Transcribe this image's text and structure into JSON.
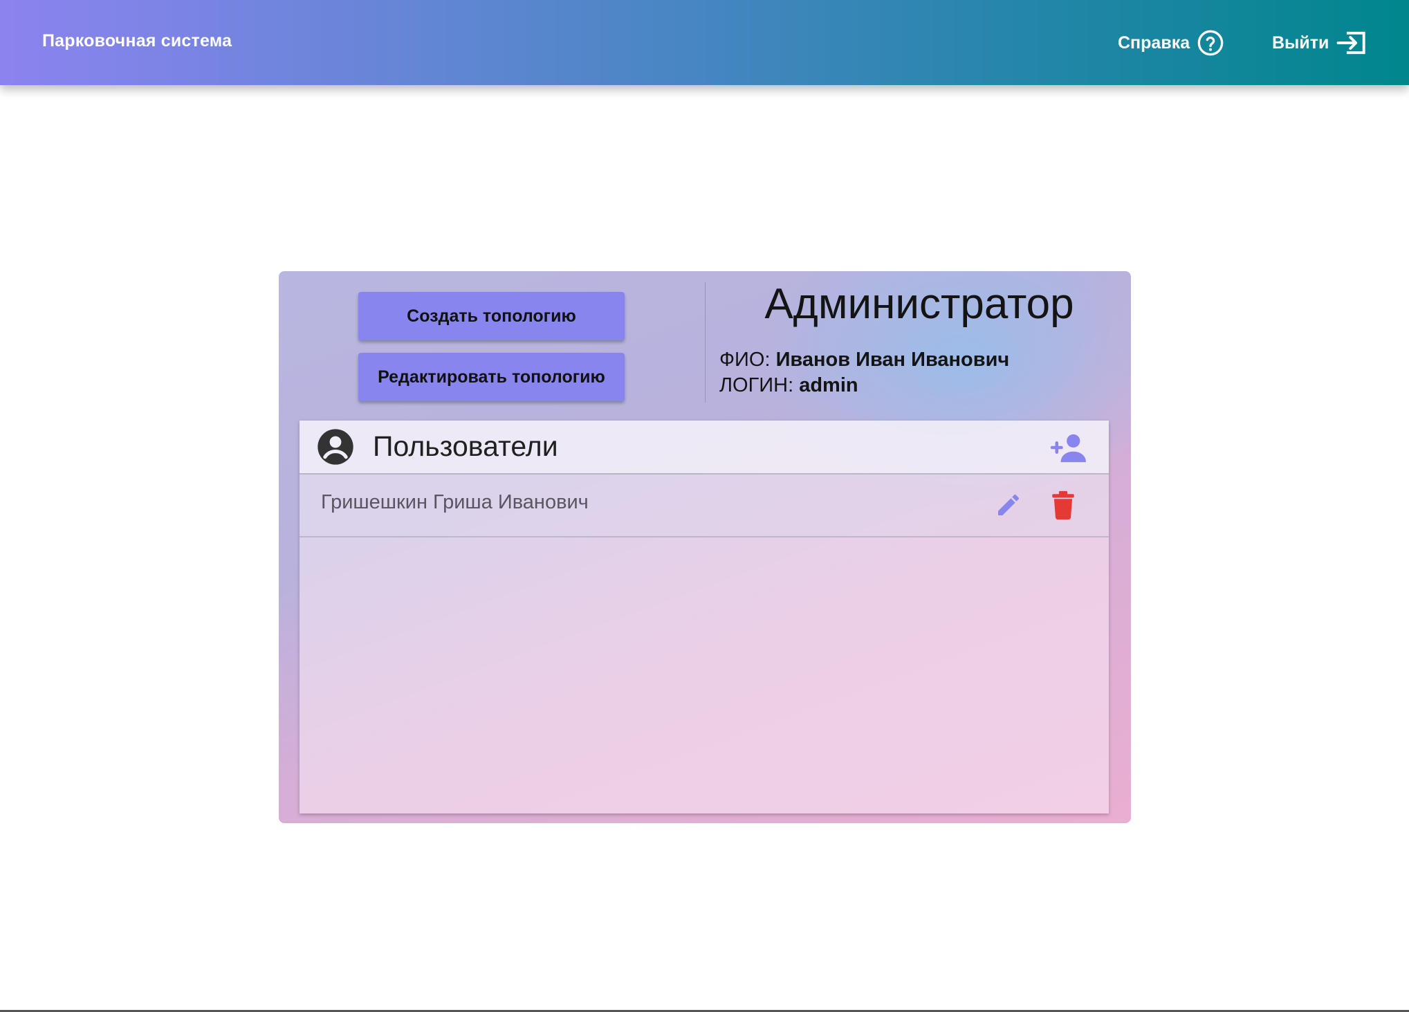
{
  "header": {
    "app_title": "Парковочная система",
    "help_label": "Справка",
    "logout_label": "Выйти"
  },
  "actions": {
    "create_topology": "Создать топологию",
    "edit_topology": "Редактировать топологию"
  },
  "profile": {
    "role": "Администратор",
    "fio_label": "ФИО:",
    "fio_value": "Иванов Иван Иванович",
    "login_label": "ЛОГИН:",
    "login_value": "admin"
  },
  "users_panel": {
    "title": "Пользователи",
    "users": [
      {
        "name": "Гришешкин Гриша Иванович"
      }
    ]
  },
  "colors": {
    "accent": "#8985ef",
    "delete": "#e53935",
    "header_start": "#8c83ef",
    "header_end": "#00868d"
  },
  "icons": {
    "help": "help-circle-icon",
    "logout": "logout-icon",
    "account": "account-circle-icon",
    "add_user": "person-add-icon",
    "edit": "pencil-icon",
    "delete": "trash-icon"
  }
}
